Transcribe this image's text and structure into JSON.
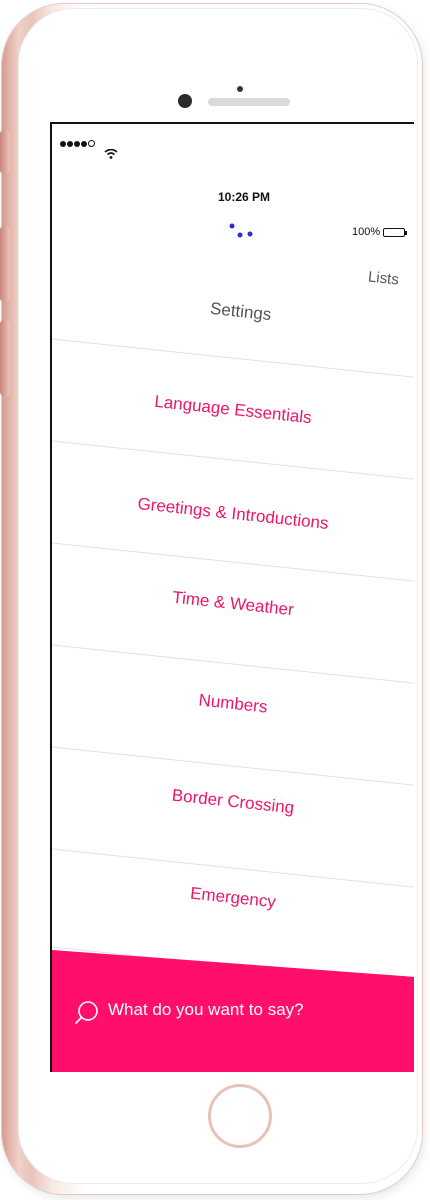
{
  "status_bar": {
    "time": "10:26 PM",
    "battery": "100%",
    "icons": [
      "signal-dots-icon",
      "wifi-icon",
      "battery-icon"
    ]
  },
  "header": {
    "logo": "three-dots-smile-icon",
    "lists_label": "Lists",
    "title": "Settings"
  },
  "categories": [
    {
      "label": "Language Essentials"
    },
    {
      "label": "Greetings & Introductions"
    },
    {
      "label": "Time & Weather"
    },
    {
      "label": "Numbers"
    },
    {
      "label": "Border Crossing"
    },
    {
      "label": "Emergency"
    }
  ],
  "search": {
    "icon": "search-icon",
    "placeholder": "What do you want to say?"
  },
  "colors": {
    "accent": "#ff0f6b",
    "category_text": "#ee1669",
    "logo": "#2a2adb",
    "phone_shell": "#e8bdb3"
  }
}
